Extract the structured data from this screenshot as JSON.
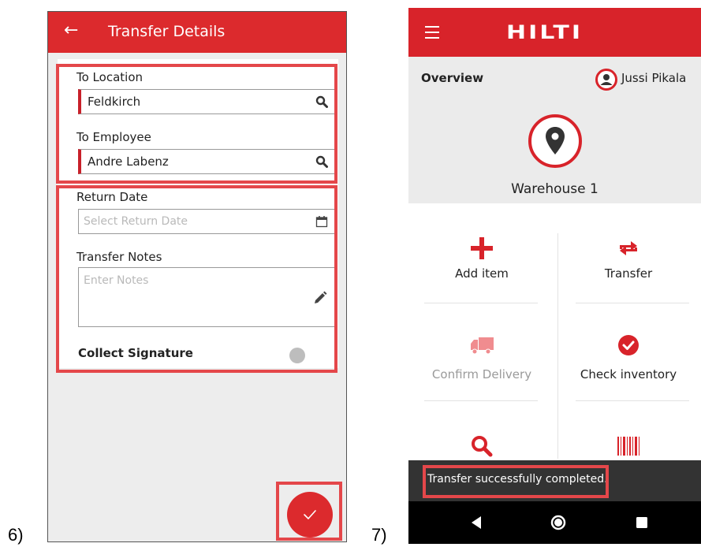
{
  "labels": {
    "left": "6)",
    "right": "7)"
  },
  "transfer_details": {
    "title": "Transfer Details",
    "to_location": {
      "label": "To Location",
      "value": "Feldkirch"
    },
    "to_employee": {
      "label": "To Employee",
      "value": "Andre Labenz"
    },
    "return_date": {
      "label": "Return Date",
      "placeholder": "Select Return Date"
    },
    "transfer_notes": {
      "label": "Transfer Notes",
      "placeholder": "Enter Notes"
    },
    "collect_signature": {
      "label": "Collect Signature",
      "enabled": false
    }
  },
  "overview": {
    "brand": "HILTI",
    "heading": "Overview",
    "user_name": "Jussi Pikala",
    "location_name": "Warehouse 1",
    "tiles": [
      {
        "label": "Add item",
        "icon": "plus-icon",
        "enabled": true
      },
      {
        "label": "Transfer",
        "icon": "transfer-arrows-icon",
        "enabled": true
      },
      {
        "label": "Confirm Delivery",
        "icon": "truck-icon",
        "enabled": false
      },
      {
        "label": "Check inventory",
        "icon": "check-circle-icon",
        "enabled": true
      },
      {
        "label": "",
        "icon": "search-icon",
        "enabled": true
      },
      {
        "label": "",
        "icon": "barcode-icon",
        "enabled": true
      }
    ],
    "snackbar": "Transfer successfully completed."
  },
  "colors": {
    "brand_red": "#d8232a",
    "highlight": "#e4474a",
    "snackbar": "#333333"
  }
}
